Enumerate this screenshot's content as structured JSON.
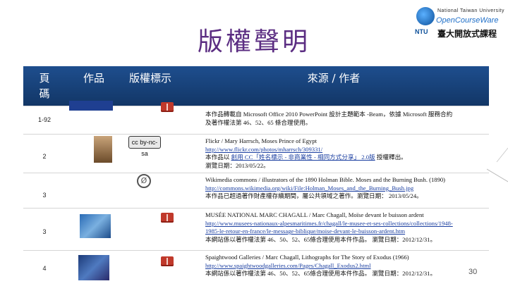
{
  "slide": {
    "title": "版權聲明",
    "page_number": "30"
  },
  "logo": {
    "org": "National Taiwan University",
    "opencourseware": "OpenCourseWare",
    "chinese": "臺大開放式課程",
    "ntu": "NTU"
  },
  "table": {
    "headers": [
      "頁碼",
      "作品",
      "版權標示",
      "來源 / 作者"
    ],
    "rows": [
      {
        "page": "1-92",
        "lines": [
          "本作品轉載自 Microsoft Office 2010 PowerPoint 設計主題範本 -Beam，依據 Microsoft 服務合約",
          "及著作權法第 46、52、65 條合理使用。"
        ]
      },
      {
        "page": "2",
        "line1": "Flickr / Mary Harrsch, Moses Prince of Egypt",
        "link": "http://www.flickr.com/photos/mharrsch/309331/",
        "line3_pre": "本作品以 ",
        "line3_link": "創用 CC「姓名標示 - 非商業性 - 相同方式分享」 2.0版",
        "line3_post": " 授權釋出。",
        "line4": "瀏覽日期：2013/05/22。",
        "cc_badge": "cc by-nc-sa"
      },
      {
        "page": "3",
        "line1": "Wikimedia commons / illustrators of the 1890 Holman Bible. Moses and the Burning Bush. (1890)",
        "link": "http://commons.wikimedia.org/wiki/File:Holman_Moses_and_the_Burning_Bush.jpg",
        "line3": "本作品已超過著作財產權存續期間，屬公共領域之著作。瀏覽日期： 2013/05/24。"
      },
      {
        "page": "3",
        "line1": "MUSÉE NATIONAL MARC CHAGALL / Marc Chagall, Moïse devant le buisson ardent",
        "link1": "http://www.musees-nationaux-alpesmaritimes.fr/chagall/le-musee-et-ses-collections/collections/1948-",
        "link2": "1985-le-retour-en-france/le-message-biblique/moise-devant-le-buisson-ardent.htm",
        "line4": "本網站係以著作權法第 46、50、52、65條合理使用本件作品。 瀏覽日期：2012/12/31。"
      },
      {
        "page": "4",
        "line1": "Spaightwood Galleries / Marc Chagall, Lithographs for The Story of Exodus (1966)",
        "link": "http://www.spaightwoodgalleries.com/Pages/Chagall_Exodus2.html",
        "line3": "本網站係以著作權法第 46、50、52、65條合理使用本件作品。 瀏覽日期：2012/12/31。"
      }
    ]
  },
  "icons": {
    "book": "book-icon",
    "cc": "creative-commons-icon",
    "pd": "public-domain-icon"
  }
}
